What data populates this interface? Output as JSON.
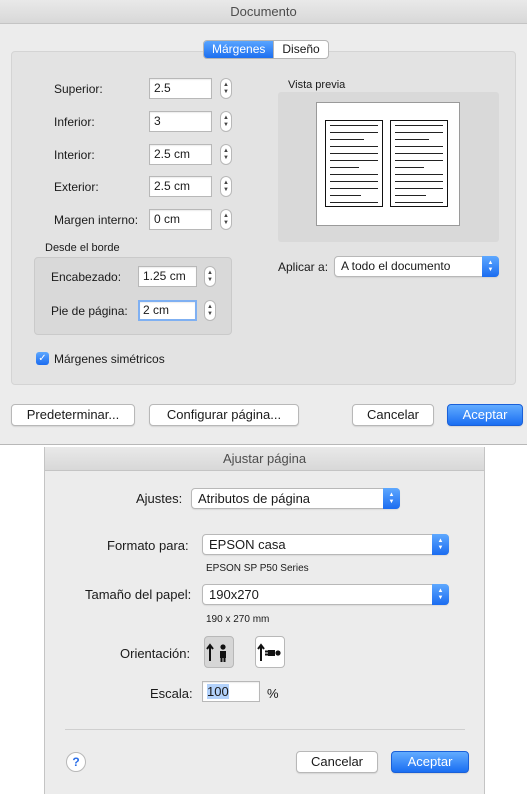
{
  "documento": {
    "title": "Documento",
    "tabs": [
      {
        "label": "Márgenes",
        "active": true
      },
      {
        "label": "Diseño",
        "active": false
      }
    ],
    "fields": [
      {
        "label": "Superior:",
        "value": "2.5"
      },
      {
        "label": "Inferior:",
        "value": "3"
      },
      {
        "label": "Interior:",
        "value": "2.5 cm"
      },
      {
        "label": "Exterior:",
        "value": "2.5 cm"
      },
      {
        "label": "Margen interno:",
        "value": "0 cm"
      }
    ],
    "from_edge": {
      "title": "Desde el borde",
      "header_label": "Encabezado:",
      "header_value": "1.25 cm",
      "footer_label": "Pie de página:",
      "footer_value": "2 cm"
    },
    "mirror_margins": {
      "label": "Márgenes simétricos",
      "checked": true
    },
    "preview_label": "Vista previa",
    "apply_label": "Aplicar a:",
    "apply_value": "A todo el documento",
    "buttons": {
      "defaults": "Predeterminar...",
      "page_setup": "Configurar página...",
      "cancel": "Cancelar",
      "ok": "Aceptar"
    }
  },
  "ajustar": {
    "title": "Ajustar página",
    "settings_label": "Ajustes:",
    "settings_value": "Atributos de página",
    "format_label": "Formato para:",
    "format_value": "EPSON casa",
    "format_detail": "EPSON SP P50 Series",
    "paper_label": "Tamaño del papel:",
    "paper_value": "190x270",
    "paper_detail": "190 x 270 mm",
    "orientation_label": "Orientación:",
    "orientation_selected": "portrait",
    "scale_label": "Escala:",
    "scale_value": "100",
    "scale_unit": "%",
    "help": "?",
    "cancel": "Cancelar",
    "ok": "Aceptar"
  },
  "colors": {
    "accent": "#1b6cf0",
    "window": "#ececec"
  }
}
